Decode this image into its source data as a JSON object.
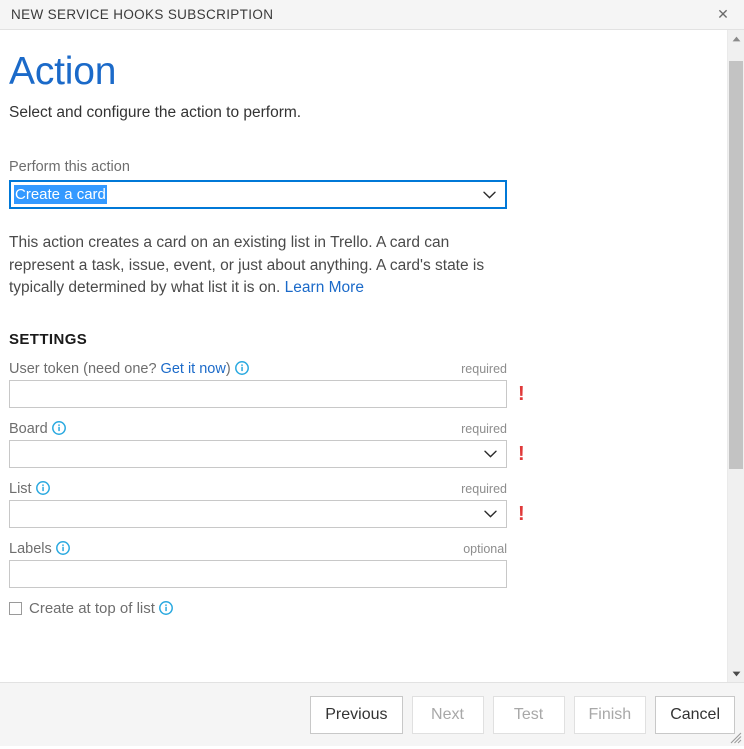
{
  "titlebar": {
    "title": "NEW SERVICE HOOKS SUBSCRIPTION",
    "close_label": "✕",
    "close_icon": "close-icon"
  },
  "page": {
    "title": "Action",
    "subtitle": "Select and configure the action to perform."
  },
  "action_select": {
    "label": "Perform this action",
    "value": "Create a card",
    "options": [
      "Create a card"
    ],
    "chevron_icon": "chevron-down-icon"
  },
  "description": {
    "text": "This action creates a card on an existing list in Trello. A card can represent a task, issue, event, or just about anything. A card's state is typically determined by what list it is on. ",
    "link_label": "Learn More"
  },
  "settings": {
    "heading": "SETTINGS",
    "info_icon": "info-icon",
    "fields": [
      {
        "label_prefix": "User token (need one? ",
        "label_link": "Get it now",
        "label_suffix": ")",
        "requirement": "required",
        "type": "text",
        "value": "",
        "has_error": true,
        "error_mark": "!"
      },
      {
        "label_prefix": "Board",
        "label_link": "",
        "label_suffix": "",
        "requirement": "required",
        "type": "select",
        "value": "",
        "has_error": true,
        "error_mark": "!"
      },
      {
        "label_prefix": "List",
        "label_link": "",
        "label_suffix": "",
        "requirement": "required",
        "type": "select",
        "value": "",
        "has_error": true,
        "error_mark": "!"
      },
      {
        "label_prefix": "Labels",
        "label_link": "",
        "label_suffix": "",
        "requirement": "optional",
        "type": "text",
        "value": "",
        "has_error": false,
        "error_mark": ""
      }
    ],
    "checkbox": {
      "label": "Create at top of list",
      "checked": false
    }
  },
  "scrollbar": {
    "up_icon": "triangle-up-icon",
    "down_icon": "triangle-down-icon"
  },
  "footer": {
    "buttons": [
      {
        "label": "Previous",
        "enabled": true
      },
      {
        "label": "Next",
        "enabled": false
      },
      {
        "label": "Test",
        "enabled": false
      },
      {
        "label": "Finish",
        "enabled": false
      },
      {
        "label": "Cancel",
        "enabled": true
      }
    ],
    "resize_grip_icon": "resize-grip-icon"
  },
  "colors": {
    "accent": "#1b6ac9",
    "selection": "#3399ff",
    "focus_border": "#0078d7",
    "error": "#e03a3a",
    "info_icon": "#2aa9e0",
    "chrome": "#f5f5f5"
  }
}
